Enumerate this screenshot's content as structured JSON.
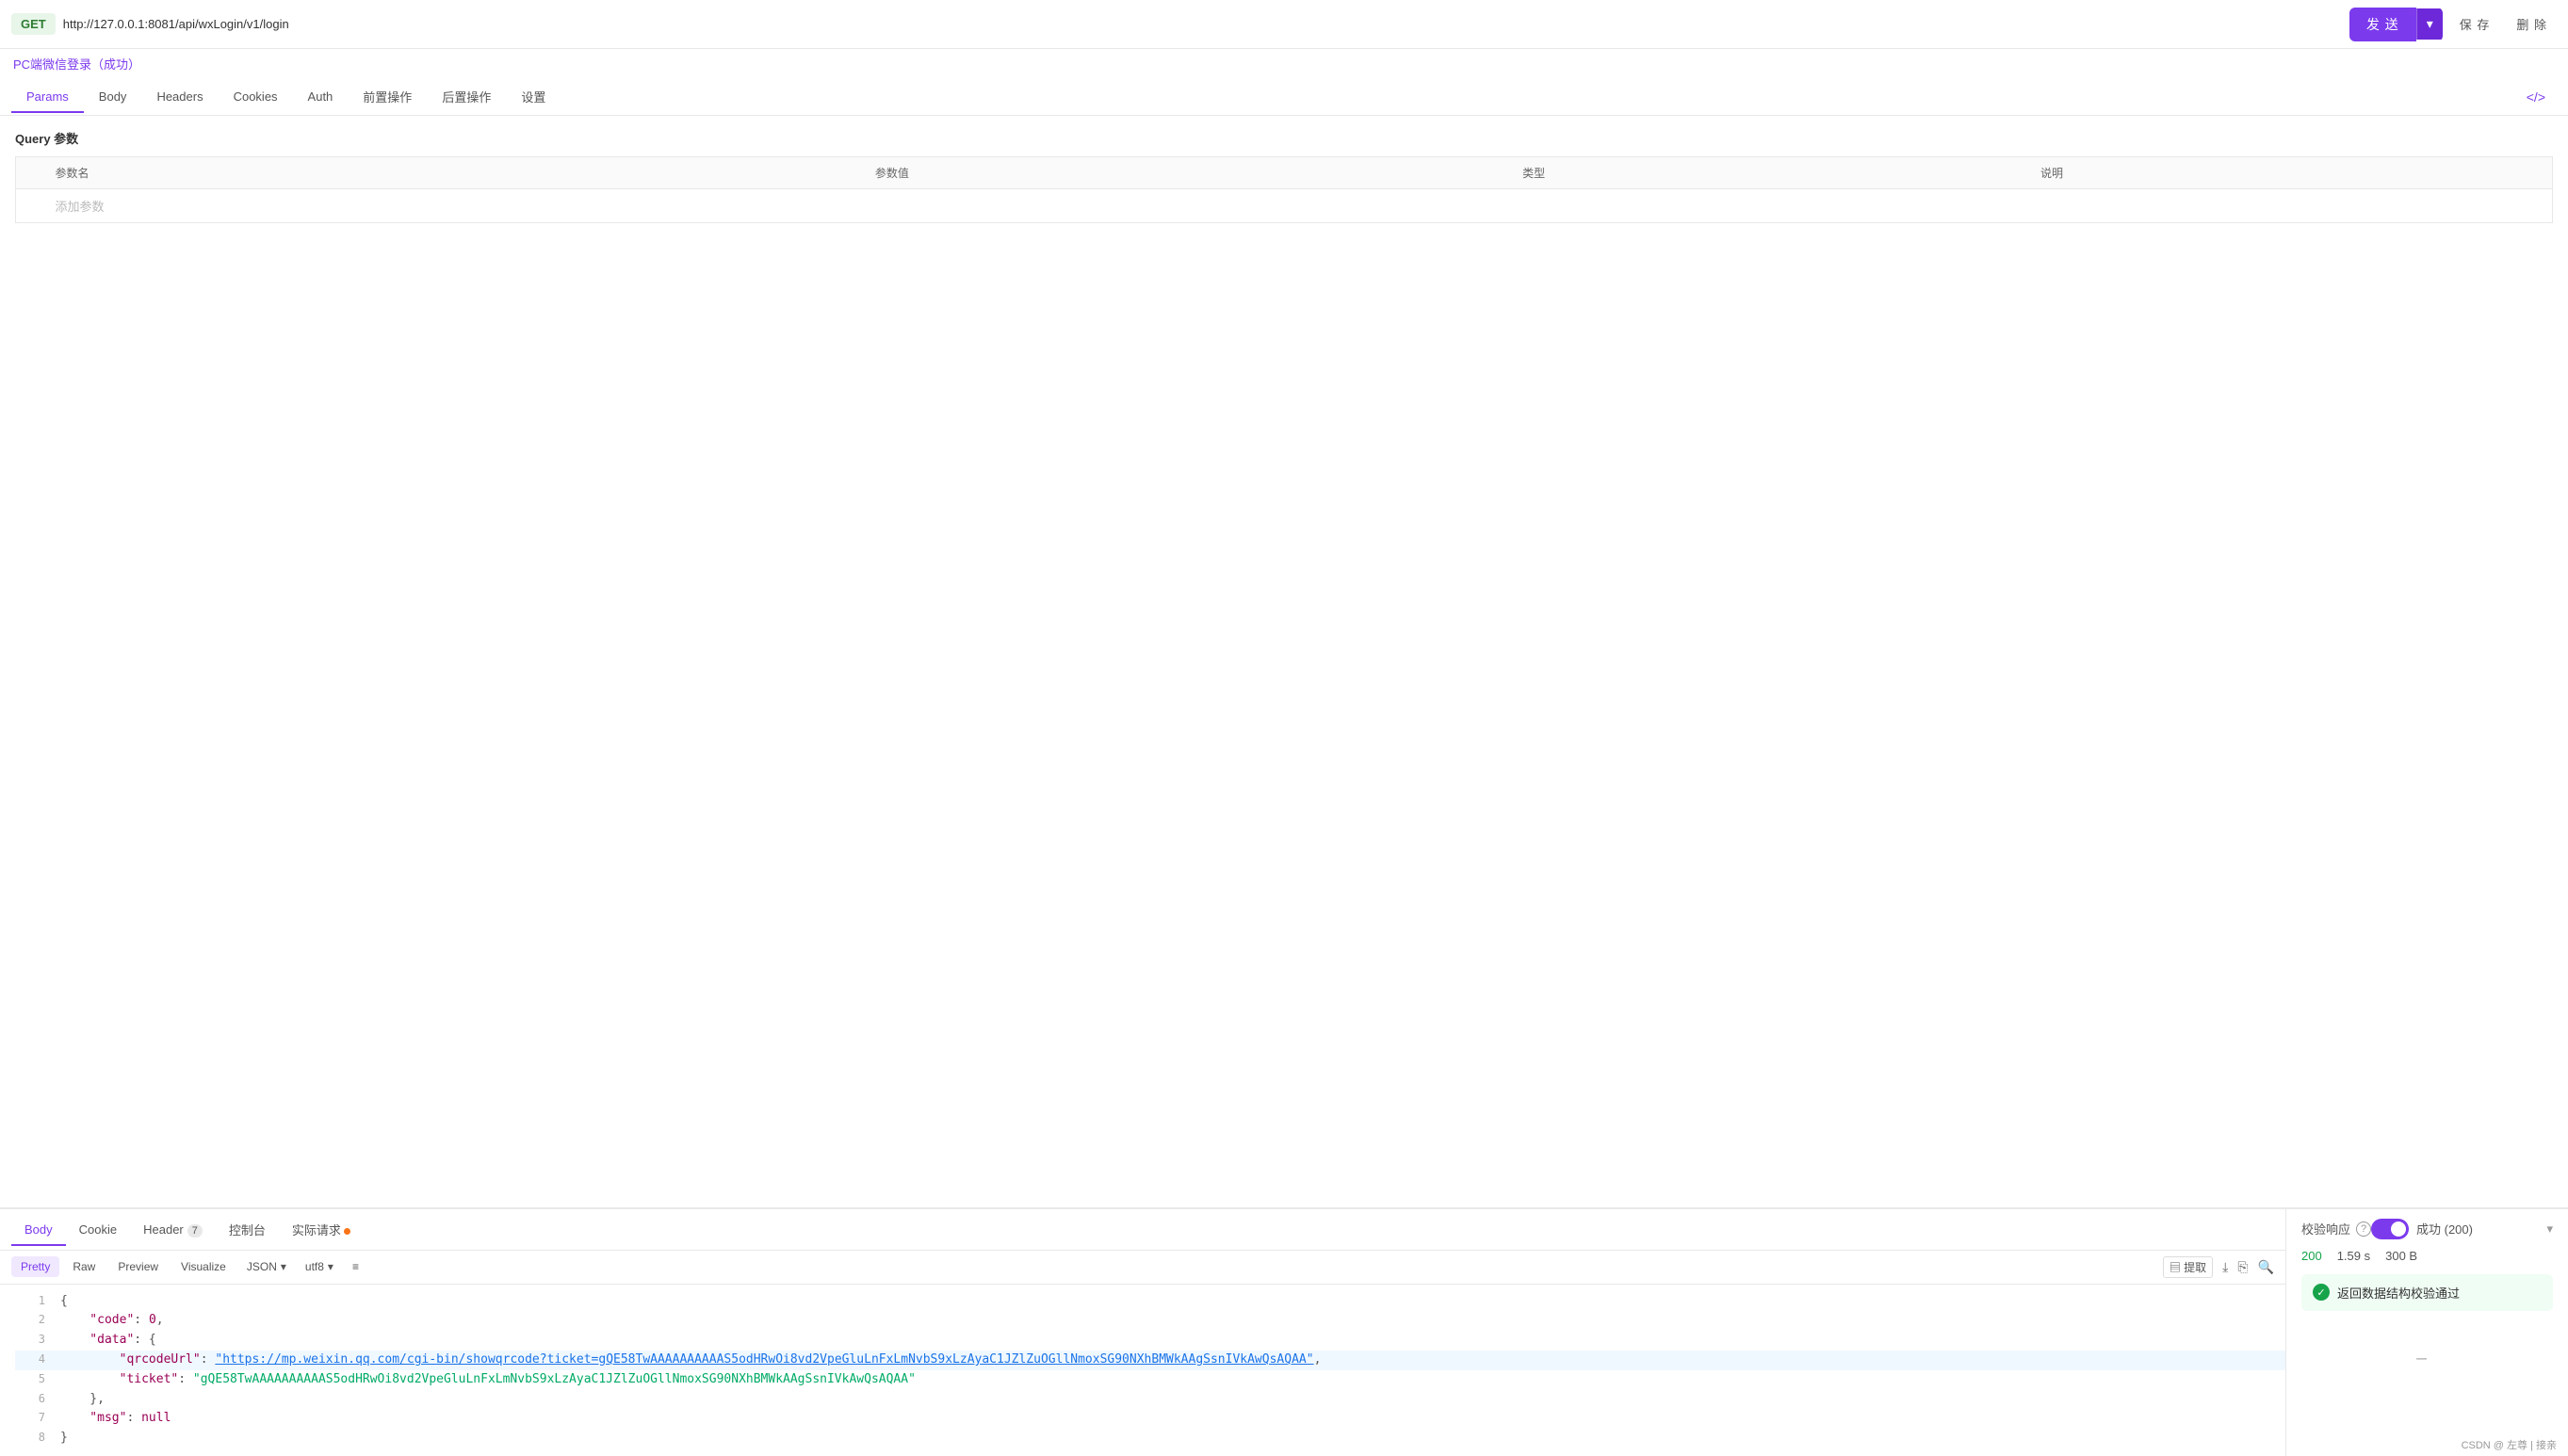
{
  "topbar": {
    "method": "GET",
    "url": "http://127.0.0.1:8081/api/wxLogin/v1/login",
    "send_label": "发 送",
    "save_label": "保 存",
    "delete_label": "删 除"
  },
  "subtitle": "PC端微信登录（成功）",
  "tabs": [
    {
      "id": "params",
      "label": "Params",
      "active": true
    },
    {
      "id": "body",
      "label": "Body",
      "active": false
    },
    {
      "id": "headers",
      "label": "Headers",
      "active": false
    },
    {
      "id": "cookies",
      "label": "Cookies",
      "active": false
    },
    {
      "id": "auth",
      "label": "Auth",
      "active": false
    },
    {
      "id": "pre-op",
      "label": "前置操作",
      "active": false
    },
    {
      "id": "post-op",
      "label": "后置操作",
      "active": false
    },
    {
      "id": "settings",
      "label": "设置",
      "active": false
    }
  ],
  "code_icon": "</>",
  "query_section": {
    "title": "Query 参数",
    "table_headers": [
      "参数名",
      "参数值",
      "类型",
      "说明"
    ],
    "add_placeholder": "添加参数"
  },
  "response_tabs": [
    {
      "id": "body",
      "label": "Body",
      "active": true
    },
    {
      "id": "cookie",
      "label": "Cookie",
      "active": false
    },
    {
      "id": "header",
      "label": "Header",
      "badge": "7",
      "active": false
    },
    {
      "id": "console",
      "label": "控制台",
      "active": false
    },
    {
      "id": "actual",
      "label": "实际请求",
      "dot": true,
      "active": false
    }
  ],
  "format_tabs": [
    {
      "id": "pretty",
      "label": "Pretty",
      "active": true
    },
    {
      "id": "raw",
      "label": "Raw",
      "active": false
    },
    {
      "id": "preview",
      "label": "Preview",
      "active": false
    },
    {
      "id": "visualize",
      "label": "Visualize",
      "active": false
    }
  ],
  "format_select": {
    "type": "JSON",
    "encoding": "utf8"
  },
  "json_lines": [
    {
      "num": 1,
      "content": "{",
      "type": "plain"
    },
    {
      "num": 2,
      "content": "\"code\": 0,",
      "type": "key-val",
      "key": "\"code\"",
      "val": "0",
      "val_type": "num"
    },
    {
      "num": 3,
      "content": "\"data\": {",
      "type": "key-obj",
      "key": "\"data\""
    },
    {
      "num": 4,
      "content": "\"qrcodeUrl\": \"https://mp.weixin.qq.com/cgi-bin/showqrcode?ticket=gQE58TwAAAAAAAAAAS5odHRwOi8vd2VpeGluLnFxLmNvbS9xLzAyaC1JZlZuOGllNmoxSG90NXhBMWkAAgSsnIVkAwQsAQAA\",",
      "type": "key-link",
      "key": "\"qrcodeUrl\"",
      "link": "https://mp.weixin.qq.com/cgi-bin/showqrcode?ticket=gQE58TwAAAAAAAAAAS5odHRwOi8vd2VpeGluLnFxLmNvbS9xLzAyaC1JZlZuOGllNmoxSG90NXhBMWkAAgSsnIVkAwQsAQAA",
      "highlighted": true
    },
    {
      "num": 5,
      "content": "\"ticket\": \"gQE58TwAAAAAAAAAAS5odHRwOi8vd2VpeGluLnFxLmNvbS9xLzAyaC1JZlZuOGllNmoxSG90NXhBMWkAAgSsnIVkAwQsAQAA\"",
      "type": "key-val",
      "key": "\"ticket\"",
      "val": "\"gQE58TwAAAAAAAAAAS5odHRwOi8vd2VpeGluLnFxLmNvbS9xLzAyaC1JZlZuOGllNmoxSG90NXhBMWkAAgSsnIVkAwQsAQAA\"",
      "val_type": "str"
    },
    {
      "num": 6,
      "content": "},",
      "type": "plain"
    },
    {
      "num": 7,
      "content": "\"msg\": null",
      "type": "key-val",
      "key": "\"msg\"",
      "val": "null",
      "val_type": "null"
    },
    {
      "num": 8,
      "content": "}",
      "type": "plain"
    }
  ],
  "validation": {
    "label": "校验响应",
    "toggle_on": true,
    "status": "成功 (200)",
    "metrics": {
      "code": "200",
      "time": "1.59 s",
      "size": "300 B"
    },
    "pass_message": "返回数据结构校验通过"
  },
  "footer": {
    "text": "CSDN @ 左尊 | 接亲"
  }
}
